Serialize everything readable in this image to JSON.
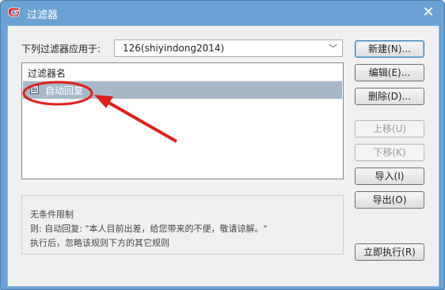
{
  "window": {
    "title": "过滤器",
    "close_glyph": "✕",
    "title_bg": "#6aa2d3",
    "annotation_color": "#e0201b"
  },
  "header": {
    "apply_to_label": "下列过滤器应用于:",
    "account_value": "126(shiyindong2014)"
  },
  "list": {
    "column_header": "过滤器名",
    "items": [
      {
        "label": "自动回复",
        "selected": true
      }
    ]
  },
  "description": {
    "line1": "无条件限制",
    "line2": "则: 自动回复: \"本人目前出差，给您带来的不便，敬请谅解。\"",
    "line3": "执行后，忽略该规则下方的其它规则"
  },
  "buttons": {
    "new": "新建(N)...",
    "edit": "编辑(E)...",
    "delete": "删除(D)...",
    "move_up": "上移(U)",
    "move_down": "下移(K)",
    "import": "导入(I)",
    "export": "导出(O)",
    "run_now": "立即执行(R)"
  }
}
